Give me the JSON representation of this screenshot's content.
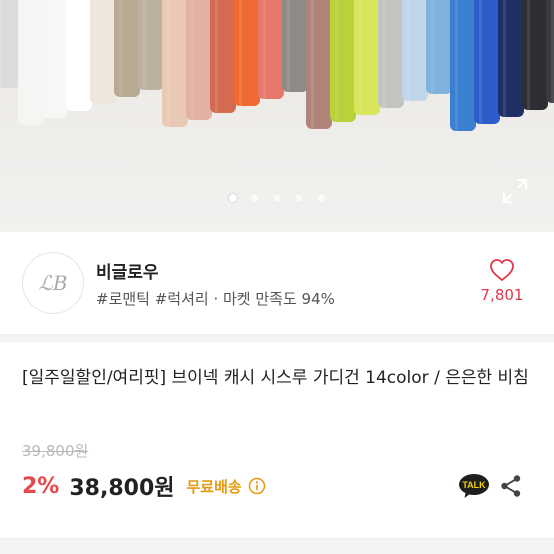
{
  "carousel": {
    "page_count": 5,
    "active_index": 0,
    "garment_colors": [
      "#dcdcdc",
      "#f5f5f3",
      "#f7f7f5",
      "#ffffff",
      "#ece6dc",
      "#b7a992",
      "#bcb1a0",
      "#e9c9b3",
      "#e3b0a4",
      "#d46a50",
      "#ef6a32",
      "#e7776a",
      "#8e8b86",
      "#b08478",
      "#b8d23a",
      "#d9e55a",
      "#c3c4c0",
      "#bfd6ea",
      "#7fb2dd",
      "#3b7fd1",
      "#2e5cc8",
      "#1f2f66",
      "#2e2e34",
      "#3a3a40"
    ]
  },
  "shop": {
    "avatar_text": "ℒB",
    "name": "비글로우",
    "tags": "#로맨틱 #럭셔리 · 마켓 만족도 94%",
    "like_count": "7,801"
  },
  "product": {
    "title": "[일주일할인/여리핏] 브이넥 캐시 시스루 가디건 14color / 은은한 비침",
    "original_price": "39,800원",
    "discount": "2%",
    "price": "38,800원",
    "shipping": "무료배송"
  },
  "actions": {
    "talk_label": "TALK"
  },
  "colors": {
    "discount": "#e5484d",
    "like": "#e03848",
    "shipping": "#e39a10"
  }
}
